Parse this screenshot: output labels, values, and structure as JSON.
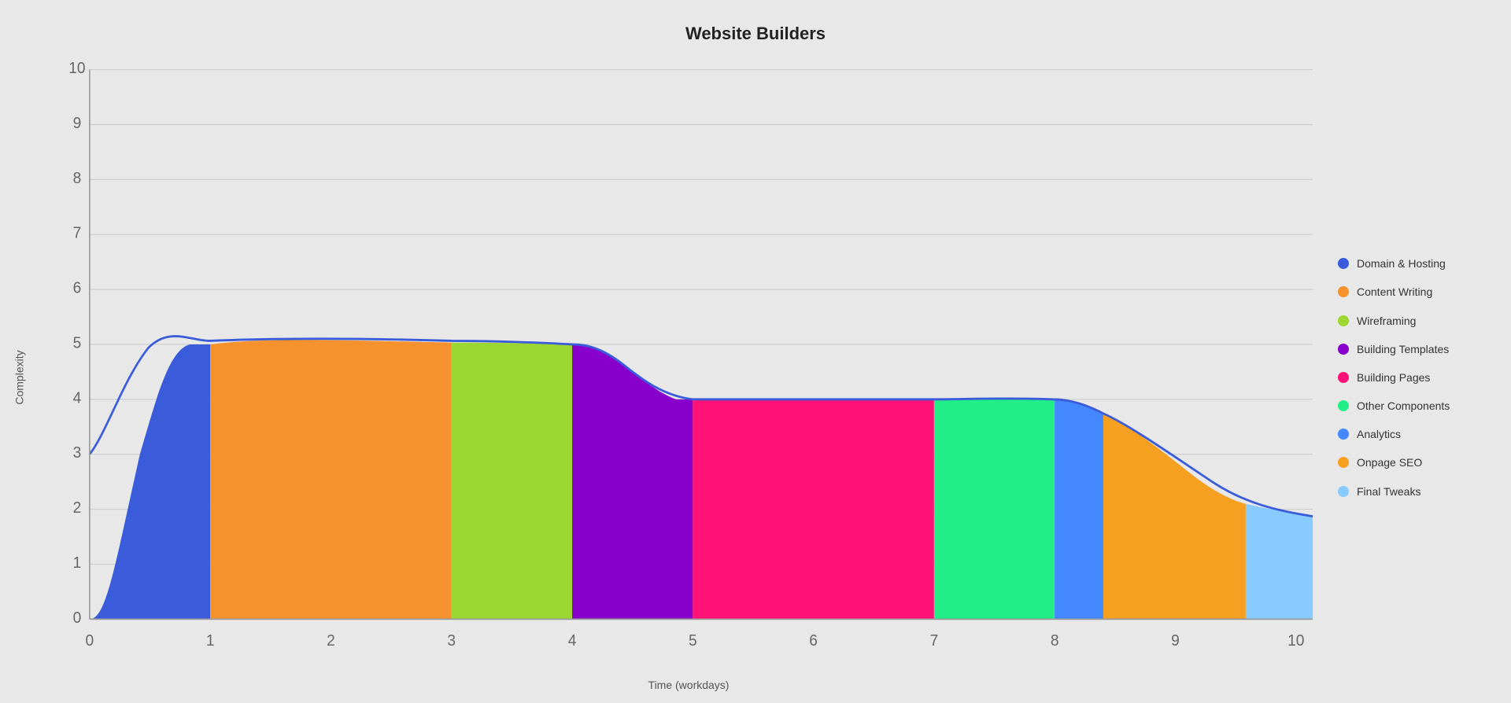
{
  "title": "Website Builders",
  "yAxisLabel": "Complexity",
  "xAxisLabel": "Time (workdays)",
  "yTicks": [
    0,
    1,
    2,
    3,
    4,
    5,
    6,
    7,
    8,
    9,
    10
  ],
  "xTicks": [
    0,
    1,
    2,
    3,
    4,
    5,
    6,
    7,
    8,
    9,
    10
  ],
  "legend": [
    {
      "label": "Domain & Hosting",
      "color": "#4169E1"
    },
    {
      "label": "Content Writing",
      "color": "#FF8C00"
    },
    {
      "label": "Wireframing",
      "color": "#9ACD32"
    },
    {
      "label": "Building Templates",
      "color": "#8B008B"
    },
    {
      "label": "Building Pages",
      "color": "#FF1493"
    },
    {
      "label": "Other Components",
      "color": "#00FA9A"
    },
    {
      "label": "Analytics",
      "color": "#4169E1"
    },
    {
      "label": "Onpage SEO",
      "color": "#FF8C00"
    },
    {
      "label": "Final Tweaks",
      "color": "#87CEEB"
    }
  ],
  "colors": {
    "domainHosting": "#3a5cdb",
    "contentWriting": "#f5922e",
    "wireframing": "#9cd631",
    "buildingTemplates": "#8800cc",
    "buildingPages": "#ff1177",
    "otherComponents": "#22ee88",
    "analytics": "#4488ff",
    "onpageSEO": "#f5a020",
    "finalTweaks": "#88ccff"
  }
}
